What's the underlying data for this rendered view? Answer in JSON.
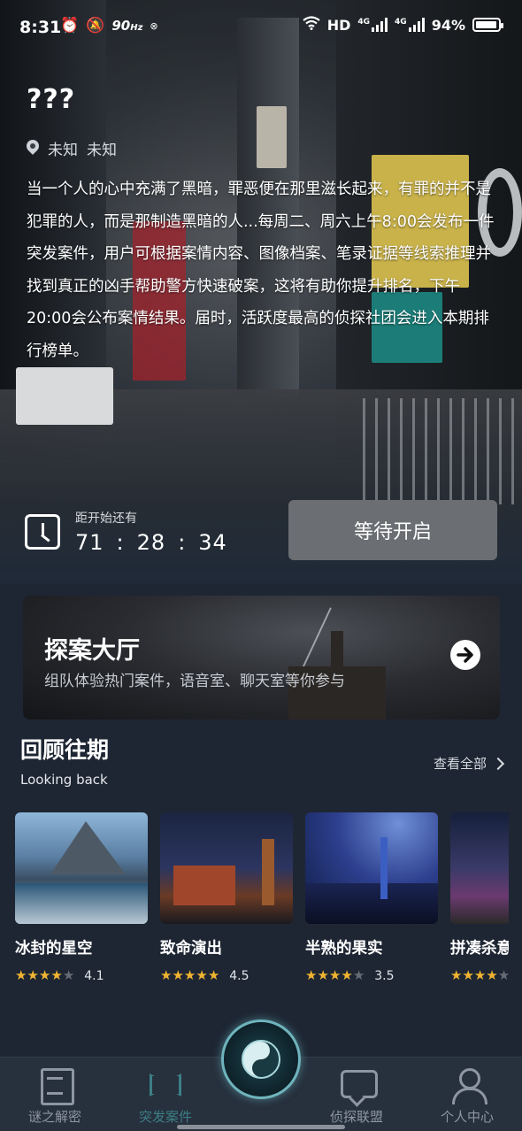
{
  "status_bar": {
    "time": "8:31",
    "refresh_rate": "90",
    "refresh_unit": "Hz",
    "network": "HD",
    "net1": "4G",
    "net2": "4G",
    "battery": "94%",
    "battery_level": 0.94
  },
  "case": {
    "title": "???",
    "location_1": "未知",
    "location_2": "未知",
    "description": "当一个人的心中充满了黑暗，罪恶便在那里滋长起来，有罪的并不是犯罪的人，而是那制造黑暗的人...每周二、周六上午8:00会发布一件突发案件，用户可根据案情内容、图像档案、笔录证据等线索推理并找到真正的凶手帮助警方快速破案，这将有助你提升排名，下午20:00会公布案情结果。届时，活跃度最高的侦探社团会进入本期排行榜单。"
  },
  "countdown": {
    "label": "距开始还有",
    "hours": "71",
    "minutes": "28",
    "seconds": "34",
    "separator": ":"
  },
  "wait_button": "等待开启",
  "hall": {
    "title": "探案大厅",
    "subtitle": "组队体验热门案件，语音室、聊天室等你参与"
  },
  "looking_back": {
    "title": "回顾往期",
    "subtitle": "Looking back",
    "view_all": "查看全部",
    "cards": [
      {
        "title": "冰封的星空",
        "rating": "4.1",
        "stars": 4
      },
      {
        "title": "致命演出",
        "rating": "4.5",
        "stars": 5
      },
      {
        "title": "半熟的果实",
        "rating": "3.5",
        "stars": 4
      },
      {
        "title": "拼凑杀意",
        "rating": "",
        "stars": 4
      }
    ]
  },
  "bottom_nav": {
    "items": [
      {
        "label": "谜之解密",
        "icon": "document-icon"
      },
      {
        "label": "突发案件",
        "icon": "bowtie-icon"
      },
      {
        "label": "侦探联盟",
        "icon": "chat-icon"
      },
      {
        "label": "个人中心",
        "icon": "person-icon"
      }
    ],
    "active_color": "#3c7f86"
  },
  "colors": {
    "star_on": "#f2b531",
    "star_off": "#676d75",
    "background": "#1e2633"
  }
}
